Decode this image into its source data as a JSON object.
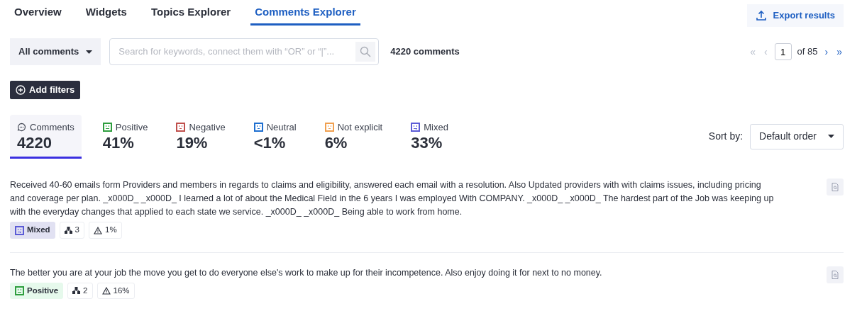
{
  "tabs": [
    {
      "label": "Overview",
      "selected": false
    },
    {
      "label": "Widgets",
      "selected": false
    },
    {
      "label": "Topics Explorer",
      "selected": false
    },
    {
      "label": "Comments Explorer",
      "selected": true
    }
  ],
  "export_button": "Export results",
  "filter_dropdown": "All comments",
  "search": {
    "placeholder": "Search for keywords, connect them with “OR” or “|”..."
  },
  "comment_count": "4220 comments",
  "pagination": {
    "first": "«",
    "previous": "‹",
    "page": "1",
    "of_label": "of 85",
    "next": "›",
    "last": "»"
  },
  "add_filters": "Add filters",
  "stats": [
    {
      "kind": "comments",
      "label": "Comments",
      "value": "4220",
      "selected": true
    },
    {
      "kind": "positive",
      "label": "Positive",
      "value": "41%",
      "selected": false,
      "color": "#2e9e3e"
    },
    {
      "kind": "negative",
      "label": "Negative",
      "value": "19%",
      "selected": false,
      "color": "#c0504d"
    },
    {
      "kind": "neutral",
      "label": "Neutral",
      "value": "<1%",
      "selected": false,
      "color": "#1e6fd0"
    },
    {
      "kind": "not_explicit",
      "label": "Not explicit",
      "value": "6%",
      "selected": false,
      "color": "#f0a050"
    },
    {
      "kind": "mixed",
      "label": "Mixed",
      "value": "33%",
      "selected": false,
      "color": "#5b5bd6"
    }
  ],
  "sort": {
    "label": "Sort by:",
    "value": "Default order"
  },
  "comments": [
    {
      "text": "Received 40-60 emails form Providers and members in regards to claims and eligibility, answered each email with a resolution. Also Updated providers with with claims issues, including pricing and coverage per plan. _x000D_ _x000D_ I learned a lot of about the Medical Field in the 6 years I was employed With COMPANY. _x000D_ _x000D_ The hardest part of the Job was keeping up with the everyday changes that applied to each state we service. _x000D_ _x000D_ Being able to work from home.",
      "sentiment": {
        "kind": "mixed",
        "label": "Mixed"
      },
      "topics": "3",
      "risk": "1%"
    },
    {
      "text": "The better you are at your job the move you get to do everyone else's work to make up for their incompetence. Also enjoy doing it for next to no money.",
      "sentiment": {
        "kind": "positive",
        "label": "Positive"
      },
      "topics": "2",
      "risk": "16%"
    }
  ]
}
